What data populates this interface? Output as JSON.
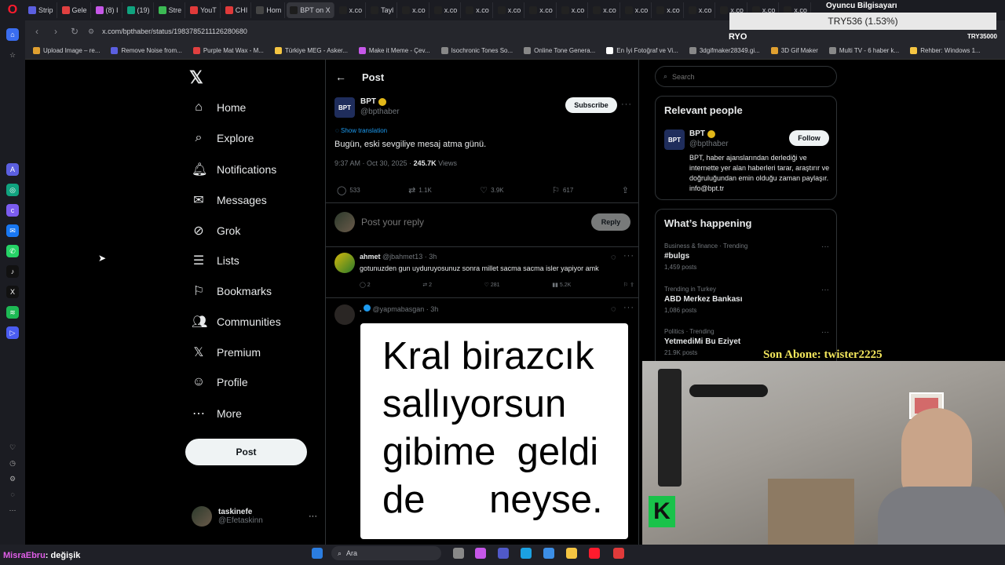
{
  "browser": {
    "tabs": [
      "Strip",
      "Gele",
      "(8) I",
      "(19)",
      "Stre",
      "YouT",
      "CHI",
      "Hom",
      "BPT on X",
      "x.co",
      "Tayl",
      "x.co",
      "x.co",
      "x.co",
      "x.co",
      "x.co",
      "x.co",
      "x.co",
      "x.co",
      "x.co",
      "x.co",
      "x.co",
      "x.co",
      "x.co"
    ],
    "url": "x.com/bpthaber/status/1983785211126280680",
    "bookmarks": [
      "Upload Image – re...",
      "Remove Noise from...",
      "Purple Mat Wax - M...",
      "Türkiye MEG - Asker...",
      "Make it Meme - Çev...",
      "Isochronic Tones So...",
      "Online Tone Genera...",
      "En İyi Fotoğraf ve Vi...",
      "3dgifmaker28349.gi...",
      "3D Gif Maker",
      "Multi TV - 6 haber k...",
      "Rehber: Windows 1..."
    ]
  },
  "nav": {
    "items": [
      "Home",
      "Explore",
      "Notifications",
      "Messages",
      "Grok",
      "Lists",
      "Bookmarks",
      "Communities",
      "Premium",
      "Profile",
      "More"
    ],
    "icons": [
      "home-icon",
      "explore-icon",
      "notifications-icon",
      "messages-icon",
      "grok-icon",
      "lists-icon",
      "bookmarks-icon",
      "communities-icon",
      "premium-icon",
      "profile-icon",
      "more-icon"
    ],
    "post_label": "Post",
    "account_name": "taskinefe",
    "account_handle": "@Efetaskinn"
  },
  "post": {
    "header_title": "Post",
    "author_name": "BPT",
    "author_handle": "@bpthaber",
    "logo_text": "BPT",
    "subscribe_label": "Subscribe",
    "translate_label": "Show translation",
    "text": "Bugün, eski sevgiliye mesaj atma günü.",
    "timestamp": "9:37 AM · Oct 30, 2025 ·",
    "views_count": "245.7K",
    "views_label": "Views",
    "replies": "533",
    "reposts": "1.1K",
    "likes": "3.9K",
    "bookmarks": "617",
    "reply_placeholder": "Post your reply",
    "reply_button": "Reply"
  },
  "replies": [
    {
      "name": "ahmet",
      "handle": "@jbahmet13 · 3h",
      "text": "gotunuzden gun uyduruyosunuz sonra millet sacma sacma isler yapiyor amk",
      "replies": "2",
      "reposts": "2",
      "likes": "281",
      "views": "5.2K"
    },
    {
      "name": ".",
      "handle": "@yapmabasgan · 3h",
      "meme_lines": [
        "Kral birazcık",
        "sallıyorsun",
        "gibime  geldi",
        "de      neyse."
      ]
    }
  ],
  "sidebar": {
    "search_placeholder": "Search",
    "relevant_title": "Relevant people",
    "person_name": "BPT",
    "person_handle": "@bpthaber",
    "follow_label": "Follow",
    "person_bio": "BPT, haber ajanslarından derlediği ve internette yer alan haberleri tarar, araştırır ve doğruluğundan emin olduğu zaman paylaşır. info@bpt.tr",
    "happening_title": "What’s happening",
    "trends": [
      {
        "context": "Business & finance · Trending",
        "title": "#bulgs",
        "count": "1,459 posts"
      },
      {
        "context": "Trending in Turkey",
        "title": "ABD Merkez Bankası",
        "count": "1,086 posts"
      },
      {
        "context": "Politics · Trending",
        "title": "YetmediMi Bu Eziyet",
        "count": "21.9K posts"
      }
    ]
  },
  "overlay": {
    "ticker": "TRY536 (1.53%)",
    "channel_title": "Oyuncu Bilgisayarı",
    "ryo": "RYO",
    "try_right": "TRY35000",
    "son_abone": "Son Abone: twister2225",
    "chat_user": "MisraEbru",
    "chat_text": ": değişik"
  },
  "taskbar": {
    "search_placeholder": "Ara"
  }
}
